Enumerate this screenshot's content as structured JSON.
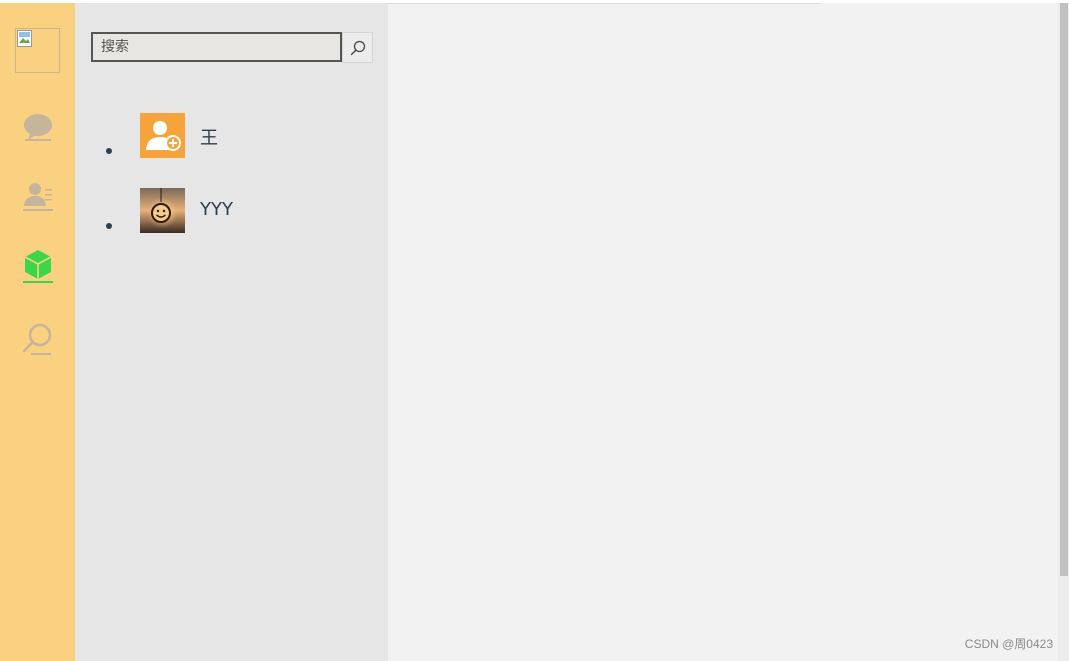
{
  "rail": {
    "items": [
      {
        "name": "chat",
        "icon": "chat-bubble-icon",
        "active": false
      },
      {
        "name": "contacts",
        "icon": "contacts-card-icon",
        "active": false
      },
      {
        "name": "apps",
        "icon": "cube-icon",
        "active": true
      },
      {
        "name": "search",
        "icon": "search-icon",
        "active": false
      }
    ],
    "colors": {
      "background": "#fad081",
      "inactive": "#c5b59a",
      "active": "#3cd64a"
    }
  },
  "search": {
    "placeholder": "搜索",
    "value": ""
  },
  "contacts": [
    {
      "name": "王",
      "avatar": "add-user-avatar"
    },
    {
      "name": "YYY",
      "avatar": "smiley-photo-avatar"
    }
  ],
  "watermark": "CSDN @周0423"
}
